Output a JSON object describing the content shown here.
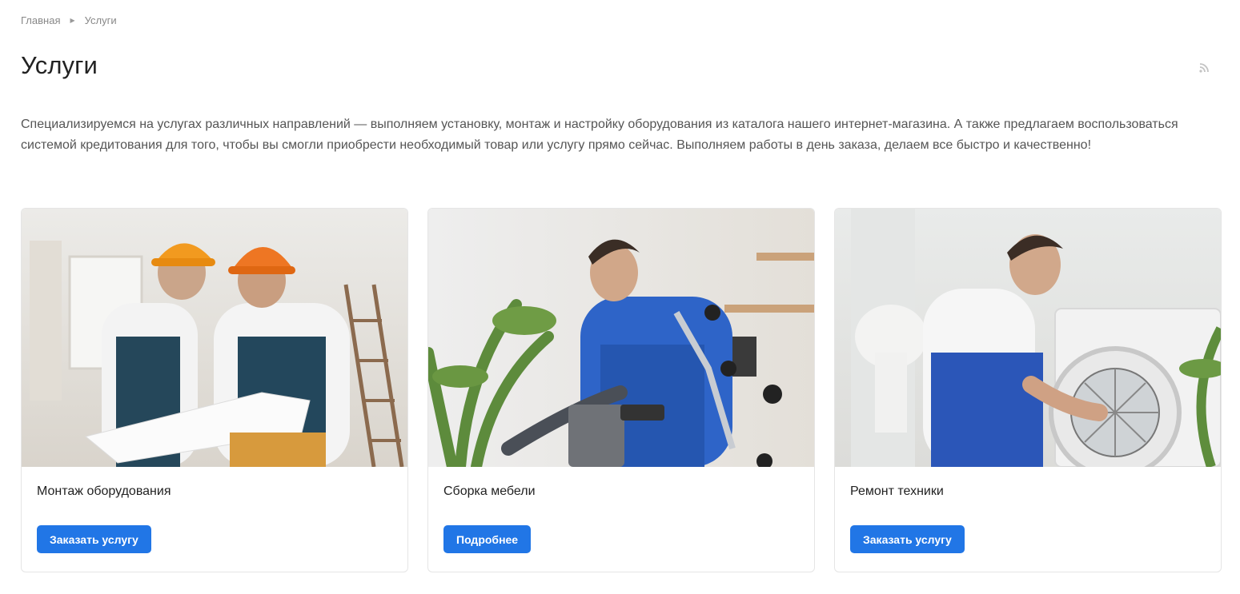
{
  "breadcrumb": {
    "items": [
      "Главная",
      "Услуги"
    ]
  },
  "page": {
    "title": "Услуги",
    "intro": "Специализируемся на услугах различных направлений — выполняем установку, монтаж и настройку оборудования из каталога нашего интернет-магазина. А также предлагаем воспользоваться системой кредитования для того, чтобы вы смогли приобрести необходимый товар или услугу прямо сейчас. Выполняем работы в день заказа, делаем все быстро и качественно!"
  },
  "icons": {
    "rss": "rss-icon"
  },
  "colors": {
    "accent": "#2176e6",
    "text": "#222222",
    "muted": "#888888"
  },
  "services": [
    {
      "title": "Монтаж оборудования",
      "button": "Заказать услугу",
      "image": "workers-with-blueprint-photo"
    },
    {
      "title": "Сборка мебели",
      "button": "Подробнее",
      "image": "furniture-assembly-photo"
    },
    {
      "title": "Ремонт техники",
      "button": "Заказать услугу",
      "image": "washing-machine-repair-photo"
    }
  ]
}
